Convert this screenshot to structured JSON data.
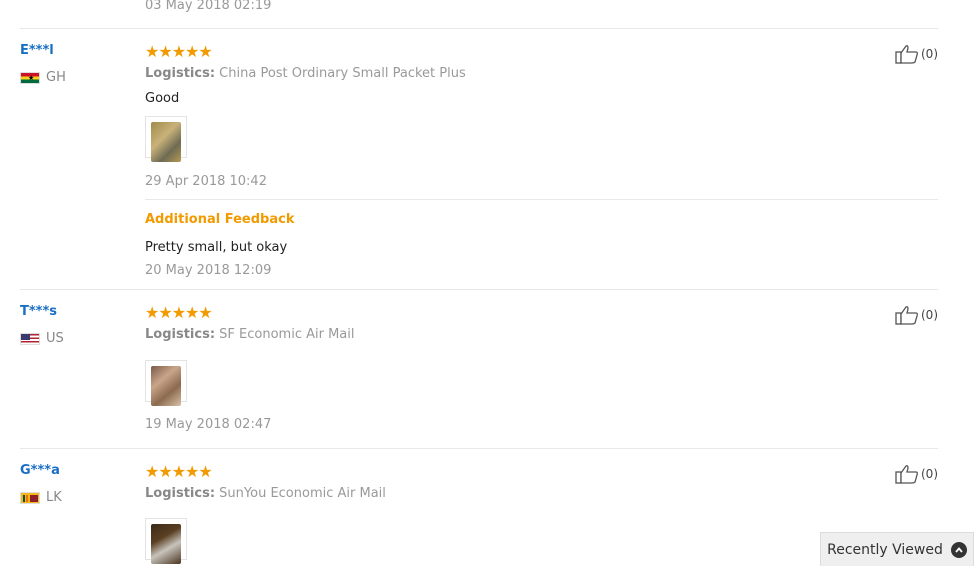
{
  "previous_review": {
    "date": "03 May 2018 02:19"
  },
  "logistics_label": "Logistics:",
  "reviews": [
    {
      "user": "E***l",
      "country": "GH",
      "stars": "★★★★★",
      "logistics": "China Post Ordinary Small Packet Plus",
      "text": "Good",
      "date": "29 Apr 2018 10:42",
      "helpful": "(0)",
      "additional": {
        "label": "Additional Feedback",
        "text": "Pretty small, but okay",
        "date": "20 May 2018 12:09"
      }
    },
    {
      "user": "T***s",
      "country": "US",
      "stars": "★★★★★",
      "logistics": "SF Economic Air Mail",
      "date": "19 May 2018 02:47",
      "helpful": "(0)"
    },
    {
      "user": "G***a",
      "country": "LK",
      "stars": "★★★★★",
      "logistics": "SunYou Economic Air Mail",
      "helpful": "(0)"
    }
  ],
  "recently_viewed": {
    "label": "Recently Viewed"
  },
  "colors": {
    "accent": "#f29b00",
    "link": "#1a6fc4"
  }
}
